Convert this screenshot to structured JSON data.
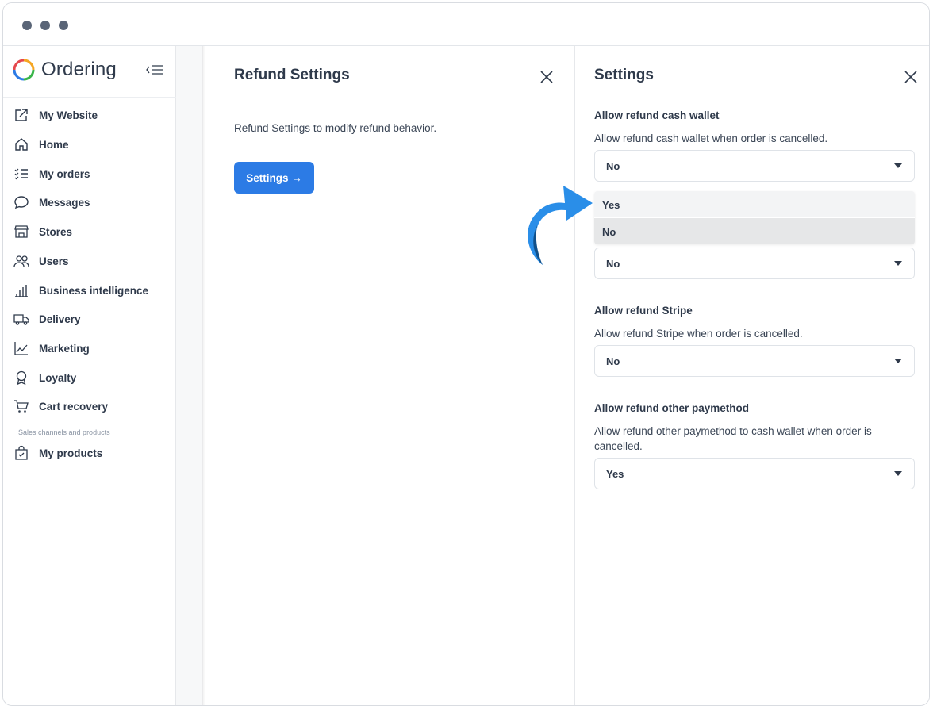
{
  "brand": {
    "name": "Ordering"
  },
  "sidebar": {
    "items": [
      {
        "label": "My Website",
        "icon": "external-link-icon"
      },
      {
        "label": "Home",
        "icon": "home-icon"
      },
      {
        "label": "My orders",
        "icon": "list-icon"
      },
      {
        "label": "Messages",
        "icon": "chat-bubble-icon"
      },
      {
        "label": "Stores",
        "icon": "store-icon"
      },
      {
        "label": "Users",
        "icon": "users-icon"
      },
      {
        "label": "Business intelligence",
        "icon": "bar-chart-icon"
      },
      {
        "label": "Delivery",
        "icon": "truck-icon"
      },
      {
        "label": "Marketing",
        "icon": "trend-line-icon"
      },
      {
        "label": "Loyalty",
        "icon": "award-icon"
      },
      {
        "label": "Cart recovery",
        "icon": "cart-icon"
      },
      {
        "label": "My products",
        "icon": "shopping-bag-icon"
      }
    ],
    "section_label": "Sales channels and products"
  },
  "refund_panel": {
    "title": "Refund Settings",
    "description": "Refund Settings to modify refund behavior.",
    "button_label": "Settings →"
  },
  "settings_panel": {
    "title": "Settings",
    "fields": [
      {
        "label": "Allow refund cash wallet",
        "description": "Allow refund cash wallet when order is cancelled.",
        "value": "No"
      },
      {
        "label": "",
        "description": "",
        "value": "No"
      },
      {
        "label": "Allow refund Stripe",
        "description": "Allow refund Stripe when order is cancelled.",
        "value": "No"
      },
      {
        "label": "Allow refund other paymethod",
        "description": "Allow refund other paymethod to cash wallet when order is cancelled.",
        "value": "Yes"
      }
    ],
    "dropdown_options": [
      "Yes",
      "No"
    ]
  },
  "colors": {
    "accent": "#2c7be5",
    "arrow": "#2a8ee8",
    "arrow_dark": "#11508a"
  }
}
